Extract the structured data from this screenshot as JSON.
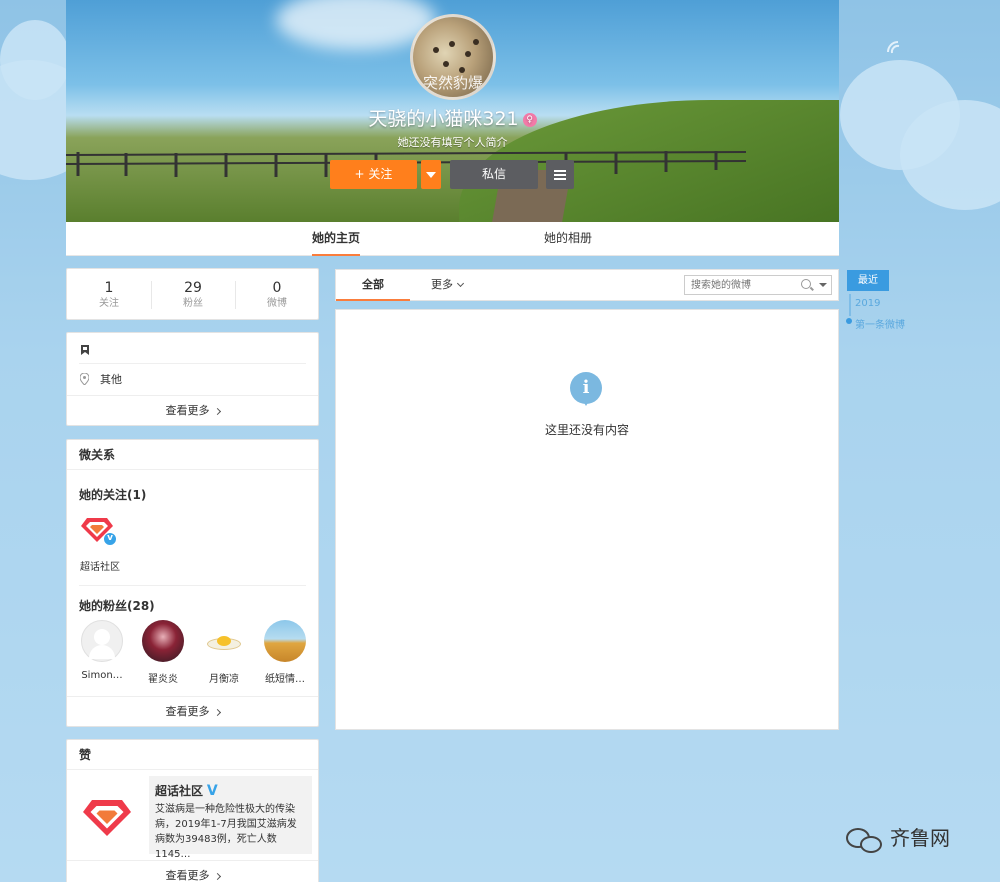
{
  "profile": {
    "avatar_watermark": "突然豹爆",
    "username": "天骁的小猫咪321",
    "verify_badge": "♀",
    "bio": "她还没有填写个人简介",
    "follow_label": "关注",
    "message_label": "私信"
  },
  "tabs": [
    "她的主页",
    "她的相册"
  ],
  "stats": [
    {
      "value": "1",
      "label": "关注"
    },
    {
      "value": "29",
      "label": "粉丝"
    },
    {
      "value": "0",
      "label": "微博"
    }
  ],
  "info": {
    "location": "其他",
    "see_more": "查看更多"
  },
  "relations": {
    "title": "微关系",
    "following_title": "她的关注(1)",
    "following": [
      {
        "name": "超话社区"
      }
    ],
    "fans_title": "她的粉丝(28)",
    "fans": [
      {
        "name": "Simon…"
      },
      {
        "name": "翟炎炎"
      },
      {
        "name": "月衡凉"
      },
      {
        "name": "纸短情…"
      }
    ],
    "see_more": "查看更多"
  },
  "likes": {
    "title": "赞",
    "card_name": "超话社区",
    "card_text": "艾滋病是一种危险性极大的传染病，2019年1-7月我国艾滋病发病数为39483例，死亡人数1145…",
    "see_more": "查看更多"
  },
  "feed": {
    "tab_all": "全部",
    "tab_more": "更多",
    "search_placeholder": "搜索她的微博",
    "empty_text": "这里还没有内容"
  },
  "timeline": {
    "recent": "最近",
    "year": "2019",
    "first": "第一条微博"
  },
  "watermark": "齐鲁网",
  "colors": {
    "accent_orange": "#ff7f1c",
    "dark_button": "#5c5d61",
    "timeline_blue": "#3a9be0"
  }
}
